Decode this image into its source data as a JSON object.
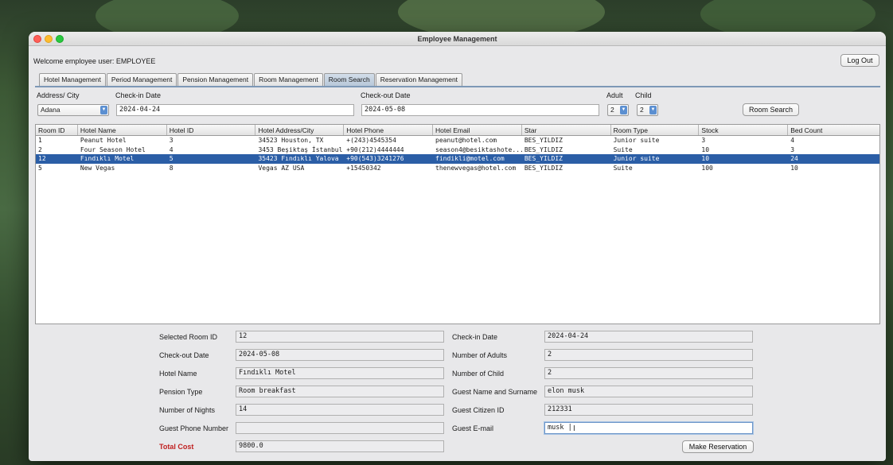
{
  "window": {
    "title": "Employee Management"
  },
  "header": {
    "welcome": "Welcome employee user: EMPLOYEE",
    "logout_label": "Log Out"
  },
  "tabs": [
    {
      "label": "Hotel Management",
      "active": false
    },
    {
      "label": "Period Management",
      "active": false
    },
    {
      "label": "Pension Management",
      "active": false
    },
    {
      "label": "Room Management",
      "active": false
    },
    {
      "label": "Room Search",
      "active": true
    },
    {
      "label": "Reservation Management",
      "active": false
    }
  ],
  "search": {
    "city_label": "Address/ City",
    "city_value": "Adana",
    "checkin_label": "Check-in Date",
    "checkin_value": "2024-04-24",
    "checkout_label": "Check-out Date",
    "checkout_value": "2024-05-08",
    "adult_label": "Adult",
    "adult_value": "2",
    "child_label": "Child",
    "child_value": "2",
    "search_button": "Room Search"
  },
  "table": {
    "headers": [
      "Room ID",
      "Hotel Name",
      "Hotel ID",
      "Hotel Address/City",
      "Hotel Phone",
      "Hotel Email",
      "Star",
      "Room Type",
      "Stock",
      "Bed Count"
    ],
    "rows": [
      [
        "1",
        "Peanut Hotel",
        "3",
        "34523 Houston, TX",
        "+(243)4545354",
        "peanut@hotel.com",
        "BES_YILDIZ",
        "Junior suite",
        "3",
        "4"
      ],
      [
        "2",
        "Four Season Hotel",
        "4",
        "3453 Beşiktaş İstanbul",
        "+90(212)4444444",
        "season4@besiktashote...",
        "BES_YILDIZ",
        "Suite",
        "10",
        "3"
      ],
      [
        "12",
        "Fındıklı Motel",
        "5",
        "35423 Fındıklı Yalova",
        "+90(543)3241276",
        "findikli@motel.com",
        "BES_YILDIZ",
        "Junior suite",
        "10",
        "24"
      ],
      [
        "5",
        "New Vegas",
        "8",
        "Vegas AZ USA",
        "+15450342",
        "thenewvegas@hotel.com",
        "BES_YILDIZ",
        "Suite",
        "100",
        "10"
      ]
    ],
    "selected_index": 2
  },
  "form": {
    "selected_room_id": {
      "label": "Selected Room ID",
      "value": "12"
    },
    "checkout_date": {
      "label": "Check-out Date",
      "value": "2024-05-08"
    },
    "hotel_name": {
      "label": "Hotel Name",
      "value": "Fındıklı Motel"
    },
    "pension_type": {
      "label": "Pension Type",
      "value": "Room breakfast"
    },
    "nights": {
      "label": "Number of Nights",
      "value": "14"
    },
    "guest_phone": {
      "label": "Guest Phone Number",
      "value": ""
    },
    "total_cost": {
      "label": "Total Cost",
      "value": "9800.0"
    },
    "checkin_date": {
      "label": "Check-in Date",
      "value": "2024-04-24"
    },
    "adults": {
      "label": "Number of Adults",
      "value": "2"
    },
    "child": {
      "label": "Number of Child",
      "value": "2"
    },
    "guest_name": {
      "label": "Guest Name and Surname",
      "value": "elon musk"
    },
    "guest_citizen_id": {
      "label": "Guest Citizen ID",
      "value": "212331"
    },
    "guest_email": {
      "label": "Guest E-mail",
      "value": "musk |"
    },
    "reserve_button": "Make Reservation"
  },
  "colors": {
    "selected_row": "#2b5ea6",
    "total_cost_label": "#c02020"
  }
}
